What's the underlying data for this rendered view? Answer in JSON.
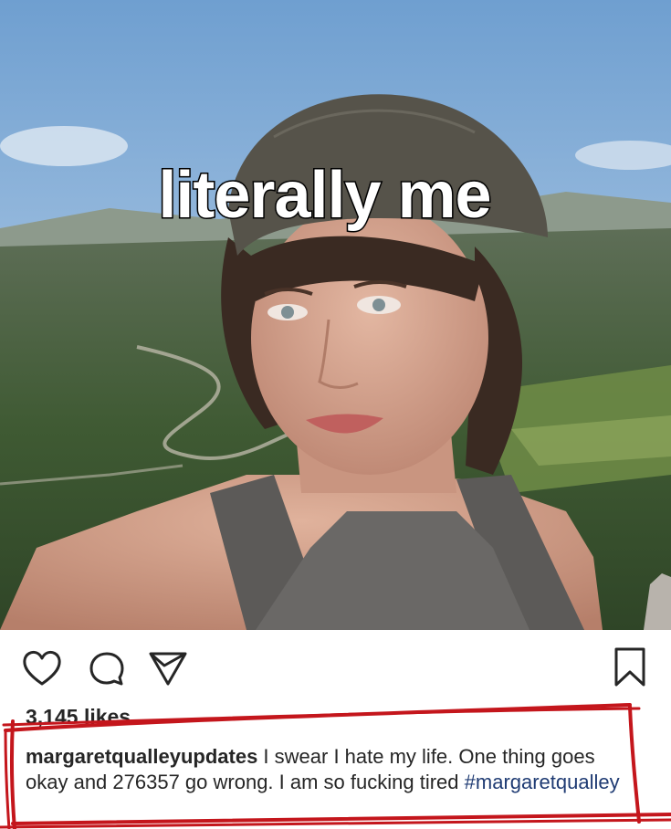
{
  "overlay": {
    "text": "literally me"
  },
  "post": {
    "likes_text": "3,145 likes",
    "username": "margaretqualleyupdates",
    "caption_text": " I swear I hate my life. One thing goes okay and 276357 go wrong. I am so fucking tired ",
    "hashtag": "#margaretqualley"
  },
  "icons": {
    "like": "heart-icon",
    "comment": "comment-bubble-icon",
    "share": "paper-plane-icon",
    "save": "bookmark-icon"
  },
  "colors": {
    "text": "#262626",
    "hashtag": "#1f3b73",
    "annotation": "#c4161c"
  }
}
